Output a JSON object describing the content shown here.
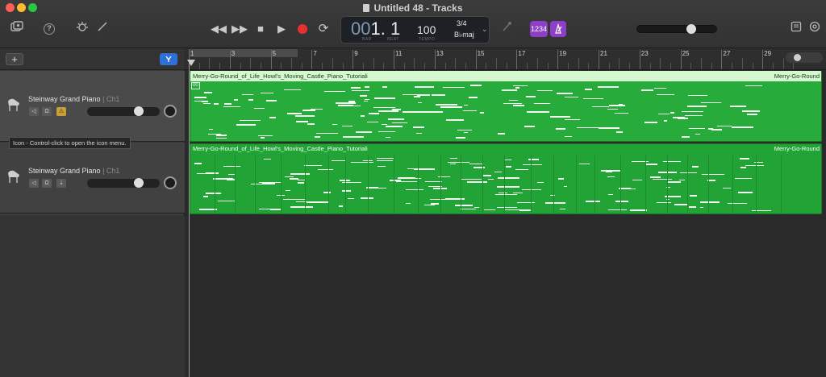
{
  "window": {
    "title": "Untitled 48 - Tracks"
  },
  "toolbar": {
    "library_icon": "library-icon",
    "help_label": "?",
    "settings_icon": "smart-controls-icon",
    "editor_icon": "scissors-icon",
    "rewind_glyph": "◀◀",
    "forward_glyph": "▶▶",
    "stop_glyph": "■",
    "play_glyph": "▶",
    "cycle_glyph": "⟳",
    "tuner_glyph": "♪",
    "count_in_label": "1234",
    "metronome_label": "⟁",
    "notes_glyph": "▤",
    "loops_glyph": "◎"
  },
  "lcd": {
    "bar_prefix": "00",
    "bar_value": "1. 1",
    "bar_label": "BAR",
    "beat_label": "BEAT",
    "tempo": "100",
    "tempo_label": "TEMPO",
    "time_signature": "3/4",
    "key": "B♭maj",
    "chevron": "⌄"
  },
  "track_list": {
    "add_label": "+",
    "smart_label": "⇣",
    "tooltip": "Icon - Control-click to open the icon menu.",
    "tracks": [
      {
        "name": "Steinway Grand Piano",
        "channel": "| Ch1",
        "mute": "◁",
        "headphones": "Ω",
        "record": "⚠"
      },
      {
        "name": "Steinway Grand Piano",
        "channel": "| Ch1",
        "mute": "◁",
        "headphones": "Ω",
        "record": "⇣"
      }
    ]
  },
  "ruler": {
    "bars": [
      "1",
      "3",
      "5",
      "7",
      "9",
      "11",
      "13",
      "15",
      "17",
      "19",
      "21",
      "23",
      "25",
      "27",
      "29"
    ]
  },
  "regions": [
    {
      "label": "Merry-Go-Round_of_Life_Howl's_Moving_Castle_Piano_Tutoriali",
      "label_right": "Merry-Go-Round",
      "loop_badge": "00"
    },
    {
      "label": "Merry-Go-Round_of_Life_Howl's_Moving_Castle_Piano_Tutoriali",
      "label_right": "Merry-Go-Round"
    }
  ],
  "colors": {
    "region_green": "#27ac3b",
    "record_red": "#e8312f",
    "accent_purple": "#8e3fc7",
    "accent_blue": "#2f6fd6"
  }
}
